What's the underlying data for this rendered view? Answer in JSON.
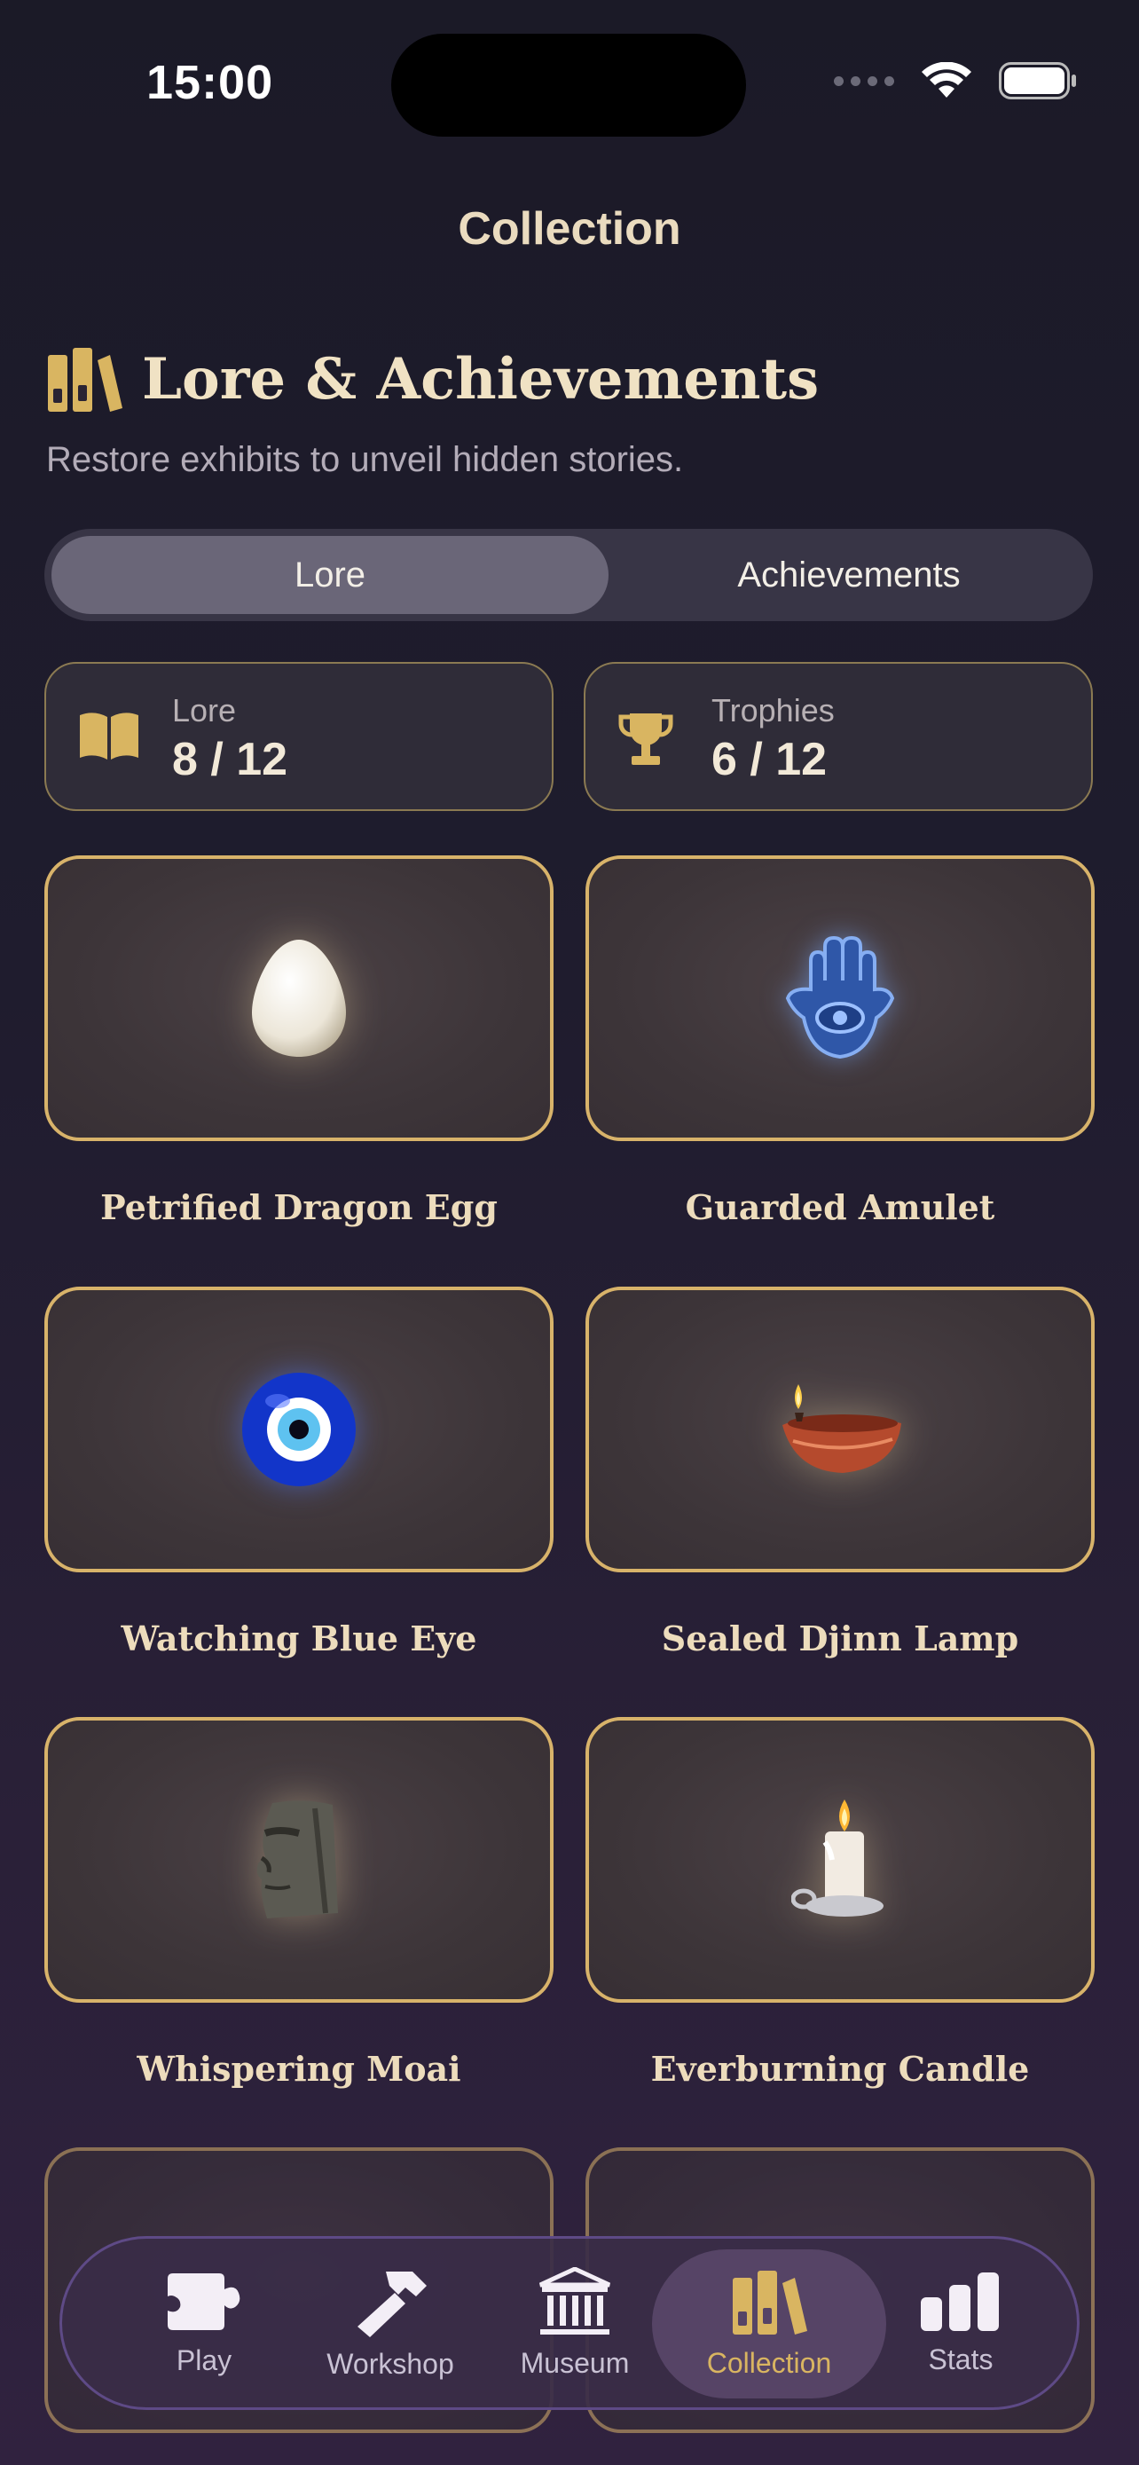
{
  "status_bar": {
    "time": "15:00"
  },
  "nav": {
    "title": "Collection"
  },
  "header": {
    "title": "Lore & Achievements",
    "subtitle": "Restore exhibits to unveil hidden stories.",
    "icon": "books-icon"
  },
  "segmented": {
    "options": [
      "Lore",
      "Achievements"
    ],
    "selected": "Lore"
  },
  "stats": [
    {
      "label": "Lore",
      "value": "8 / 12",
      "icon": "open-book-icon"
    },
    {
      "label": "Trophies",
      "value": "6 / 12",
      "icon": "trophy-icon"
    }
  ],
  "exhibits": [
    {
      "name": "Petrified Dragon Egg",
      "icon": "egg-icon"
    },
    {
      "name": "Guarded Amulet",
      "icon": "hamsa-icon"
    },
    {
      "name": "Watching Blue Eye",
      "icon": "nazar-eye-icon"
    },
    {
      "name": "Sealed Djinn Lamp",
      "icon": "oil-lamp-icon"
    },
    {
      "name": "Whispering Moai",
      "icon": "moai-icon"
    },
    {
      "name": "Everburning Candle",
      "icon": "candle-icon"
    }
  ],
  "tabbar": {
    "items": [
      {
        "label": "Play",
        "icon": "puzzle-icon"
      },
      {
        "label": "Workshop",
        "icon": "hammer-icon"
      },
      {
        "label": "Museum",
        "icon": "museum-icon"
      },
      {
        "label": "Collection",
        "icon": "books-icon"
      },
      {
        "label": "Stats",
        "icon": "bar-chart-icon"
      }
    ],
    "active": "Collection"
  },
  "colors": {
    "accent": "#d9b561",
    "card_border": "#d8b36a",
    "background": "#1f1c2e"
  }
}
